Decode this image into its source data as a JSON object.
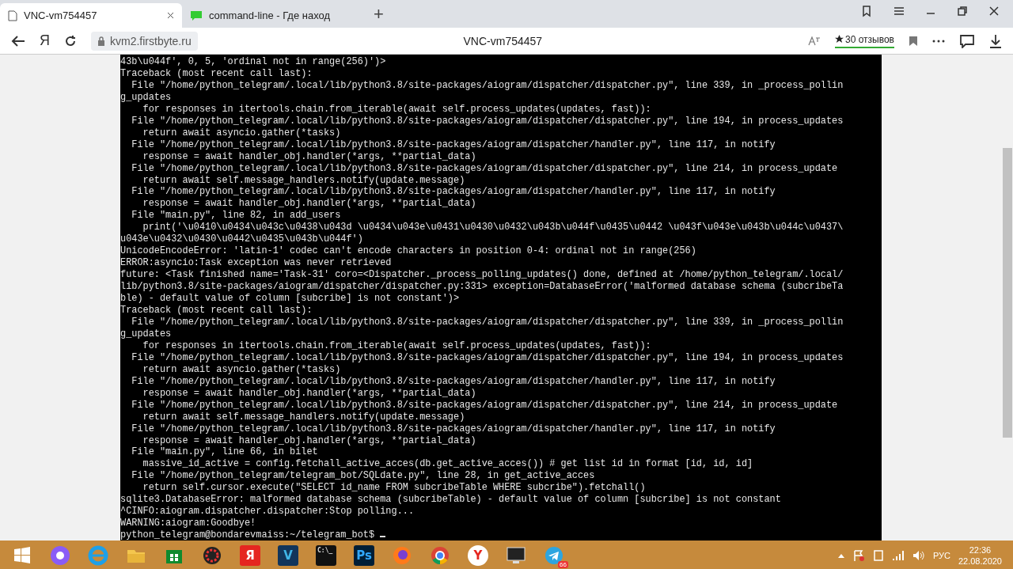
{
  "tabs": [
    {
      "title": "VNC-vm754457",
      "selected": true,
      "kind": "page"
    },
    {
      "title": "command-line - Где наход",
      "selected": false,
      "kind": "ask"
    }
  ],
  "new_tab": "+",
  "toolbar": {
    "yandex_button": "Я",
    "url": "kvm2.firstbyte.ru",
    "page_title": "VNC-vm754457",
    "reviews": "30 отзывов"
  },
  "terminal": {
    "lines": [
      "43b\\u044f', 0, 5, 'ordinal not in range(256)')>",
      "Traceback (most recent call last):",
      "  File \"/home/python_telegram/.local/lib/python3.8/site-packages/aiogram/dispatcher/dispatcher.py\", line 339, in _process_pollin",
      "g_updates",
      "    for responses in itertools.chain.from_iterable(await self.process_updates(updates, fast)):",
      "  File \"/home/python_telegram/.local/lib/python3.8/site-packages/aiogram/dispatcher/dispatcher.py\", line 194, in process_updates",
      "    return await asyncio.gather(*tasks)",
      "  File \"/home/python_telegram/.local/lib/python3.8/site-packages/aiogram/dispatcher/handler.py\", line 117, in notify",
      "    response = await handler_obj.handler(*args, **partial_data)",
      "  File \"/home/python_telegram/.local/lib/python3.8/site-packages/aiogram/dispatcher/dispatcher.py\", line 214, in process_update",
      "    return await self.message_handlers.notify(update.message)",
      "  File \"/home/python_telegram/.local/lib/python3.8/site-packages/aiogram/dispatcher/handler.py\", line 117, in notify",
      "    response = await handler_obj.handler(*args, **partial_data)",
      "  File \"main.py\", line 82, in add_users",
      "    print('\\u0410\\u0434\\u043c\\u0438\\u043d \\u0434\\u043e\\u0431\\u0430\\u0432\\u043b\\u044f\\u0435\\u0442 \\u043f\\u043e\\u043b\\u044c\\u0437\\",
      "u043e\\u0432\\u0430\\u0442\\u0435\\u043b\\u044f')",
      "UnicodeEncodeError: 'latin-1' codec can't encode characters in position 0-4: ordinal not in range(256)",
      "ERROR:asyncio:Task exception was never retrieved",
      "future: <Task finished name='Task-31' coro=<Dispatcher._process_polling_updates() done, defined at /home/python_telegram/.local/",
      "lib/python3.8/site-packages/aiogram/dispatcher/dispatcher.py:331> exception=DatabaseError('malformed database schema (subcribeTa",
      "ble) - default value of column [subcribe] is not constant')>",
      "Traceback (most recent call last):",
      "  File \"/home/python_telegram/.local/lib/python3.8/site-packages/aiogram/dispatcher/dispatcher.py\", line 339, in _process_pollin",
      "g_updates",
      "    for responses in itertools.chain.from_iterable(await self.process_updates(updates, fast)):",
      "  File \"/home/python_telegram/.local/lib/python3.8/site-packages/aiogram/dispatcher/dispatcher.py\", line 194, in process_updates",
      "    return await asyncio.gather(*tasks)",
      "  File \"/home/python_telegram/.local/lib/python3.8/site-packages/aiogram/dispatcher/handler.py\", line 117, in notify",
      "    response = await handler_obj.handler(*args, **partial_data)",
      "  File \"/home/python_telegram/.local/lib/python3.8/site-packages/aiogram/dispatcher/dispatcher.py\", line 214, in process_update",
      "    return await self.message_handlers.notify(update.message)",
      "  File \"/home/python_telegram/.local/lib/python3.8/site-packages/aiogram/dispatcher/handler.py\", line 117, in notify",
      "    response = await handler_obj.handler(*args, **partial_data)",
      "  File \"main.py\", line 66, in bilet",
      "    massive_id_active = config.fetchall_active_acces(db.get_active_acces()) # get list id in format [id, id, id]",
      "  File \"/home/python_telegram/telegram_bot/SQLdate.py\", line 28, in get_active_acces",
      "    return self.cursor.execute(\"SELECT id_name FROM subcribeTable WHERE subcribe\").fetchall()",
      "sqlite3.DatabaseError: malformed database schema (subcribeTable) - default value of column [subcribe] is not constant",
      "^CINFO:aiogram.dispatcher.dispatcher:Stop polling...",
      "WARNING:aiogram:Goodbye!"
    ],
    "prompt": "python_telegram@bondarevmaiss:~/telegram_bot$"
  },
  "taskbar": {
    "apps": [
      {
        "kind": "start"
      },
      {
        "kind": "alice"
      },
      {
        "kind": "ie"
      },
      {
        "kind": "folder"
      },
      {
        "kind": "store"
      },
      {
        "kind": "gear"
      },
      {
        "kind": "yandex",
        "glyph": "Я"
      },
      {
        "kind": "v",
        "glyph": "V"
      },
      {
        "kind": "cmd",
        "glyph": "C:\\_"
      },
      {
        "kind": "ps",
        "glyph": "Ps"
      },
      {
        "kind": "firefox"
      },
      {
        "kind": "chrome"
      },
      {
        "kind": "ybrowser",
        "glyph": "Y"
      },
      {
        "kind": "monitor"
      },
      {
        "kind": "telegram",
        "badge": "66"
      }
    ],
    "language": "РУС",
    "time": "22:36",
    "date": "22.08.2020"
  }
}
